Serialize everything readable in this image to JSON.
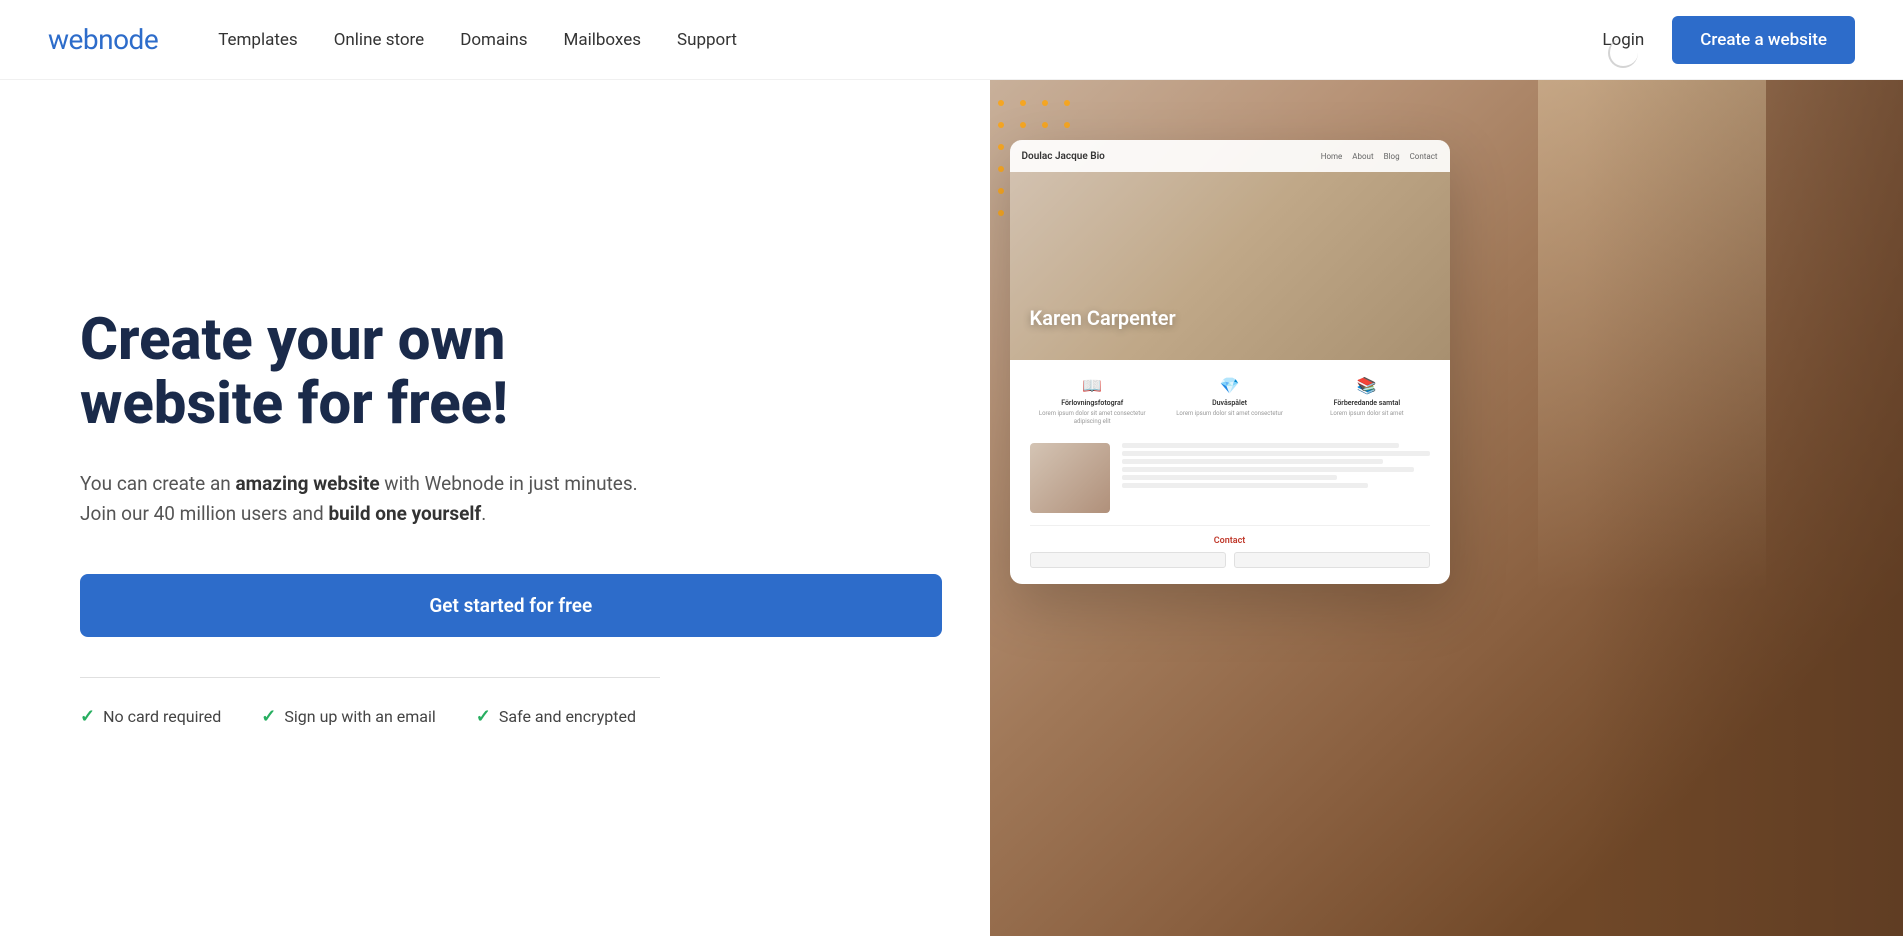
{
  "header": {
    "logo": "webnode",
    "nav": {
      "items": [
        {
          "label": "Templates",
          "href": "#"
        },
        {
          "label": "Online store",
          "href": "#"
        },
        {
          "label": "Domains",
          "href": "#"
        },
        {
          "label": "Mailboxes",
          "href": "#"
        },
        {
          "label": "Support",
          "href": "#"
        }
      ]
    },
    "login_label": "Login",
    "create_btn_label": "Create a website"
  },
  "hero": {
    "heading_line1": "Create your own",
    "heading_line2": "website for free!",
    "description_prefix": "You can create an ",
    "description_bold1": "amazing website",
    "description_middle": " with Webnode in just minutes. Join our 40 million users and ",
    "description_bold2": "build one yourself",
    "description_suffix": ".",
    "cta_label": "Get started for free",
    "trust_items": [
      {
        "label": "No card required"
      },
      {
        "label": "Sign up with an email"
      },
      {
        "label": "Safe and encrypted"
      }
    ]
  },
  "preview_card": {
    "nav_logo": "Doulac Jacque Bio",
    "nav_links": [
      "Home",
      "About",
      "Blog",
      "Contact"
    ],
    "hero_name": "Karen Carpenter",
    "feature1_title": "Förlovningsfotograf",
    "feature2_title": "Duvåspålet",
    "feature3_title": "Förberedande samtal",
    "contact_title": "Contact"
  },
  "dots": {
    "color": "#f5a623",
    "count": 48
  },
  "colors": {
    "primary": "#2d6cca",
    "text_dark": "#1a2a4a",
    "check_green": "#27ae60",
    "orange_dots": "#f5a623"
  }
}
